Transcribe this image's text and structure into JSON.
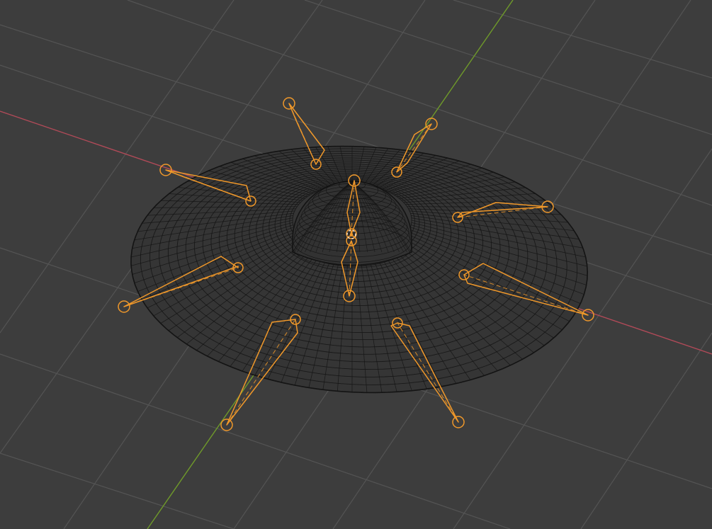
{
  "viewport": {
    "mode": "wireframe",
    "background_color": "#3d3d3d",
    "grid_color": "#545454",
    "x_axis_color": "#b04a58",
    "y_axis_color": "#6f9a2a",
    "wire_color": "#141414",
    "selection_color": "#f0982a"
  },
  "mesh": {
    "name_icon": "hat-mesh-wireframe",
    "shape": "wide brim with central dome"
  },
  "armature": {
    "bone_count": 10,
    "center_bone_count": 1
  }
}
